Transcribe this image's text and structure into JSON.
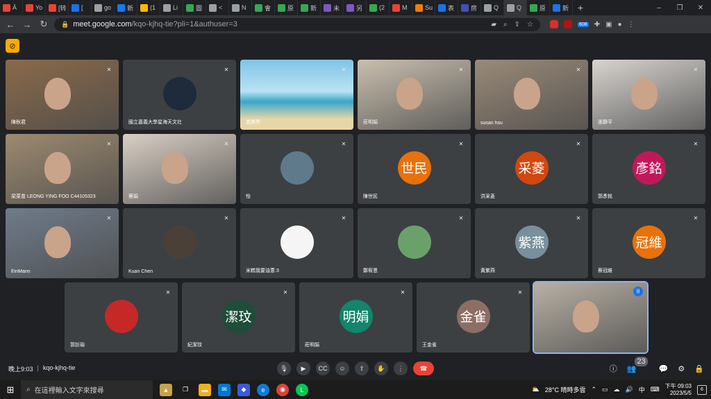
{
  "browser": {
    "tabs": [
      "Ä",
      "Yo",
      "[转",
      "[",
      "go",
      "新",
      "(1",
      "Li",
      "圖",
      "<",
      "N",
      "會",
      "原",
      "新",
      "未",
      "另",
      "(2",
      "M",
      "Su",
      "表",
      "房",
      "Q",
      "Q",
      "原",
      "新"
    ],
    "url_host": "meet.google.com",
    "url_path": "/kqo-kjhq-tie?pli=1&authuser=3",
    "ext_badge": "608"
  },
  "participants": [
    {
      "name": "陳秋君",
      "type": "video",
      "bg": "#8a6a4a"
    },
    {
      "name": "國立嘉義大學星海天文社",
      "type": "avatar",
      "initials": "",
      "color": "#1e2b3a"
    },
    {
      "name": "曾美秀",
      "type": "beach"
    },
    {
      "name": "莊明娟",
      "type": "video",
      "bg": "#c9bfae"
    },
    {
      "name": "susan hsu",
      "type": "video",
      "bg": "#9a8a78"
    },
    {
      "name": "張靜平",
      "type": "video",
      "bg": "#d8d4cf"
    },
    {
      "name": "梁菜苗 LEONG YING FOO C44105323",
      "type": "video",
      "bg": "#9d8a70"
    },
    {
      "name": "蔡娟",
      "type": "video",
      "bg": "#d9cfc4"
    },
    {
      "name": "怡",
      "type": "avatar",
      "initials": "",
      "color": "#5f7a8a"
    },
    {
      "name": "陳世民",
      "type": "avatar",
      "initials": "世民",
      "color": "#e8710a"
    },
    {
      "name": "洪采菱",
      "type": "avatar",
      "initials": "采菱",
      "color": "#d2480e"
    },
    {
      "name": "郭彥銘",
      "type": "avatar",
      "initials": "彥銘",
      "color": "#c2185b"
    },
    {
      "name": "EinMann",
      "type": "video",
      "bg": "#6f7b8a"
    },
    {
      "name": "Kuan Chen",
      "type": "avatar",
      "initials": "",
      "color": "#4a4038"
    },
    {
      "name": "米糕我要油蔥:3",
      "type": "avatar",
      "initials": "",
      "color": "#f5f5f5"
    },
    {
      "name": "鄭宥恩",
      "type": "avatar",
      "initials": "",
      "color": "#6aa16a"
    },
    {
      "name": "黃紫燕",
      "type": "avatar",
      "initials": "紫燕",
      "color": "#78909c"
    },
    {
      "name": "蔡冠維",
      "type": "avatar",
      "initials": "冠維",
      "color": "#e8710a"
    },
    {
      "name": "郭訢瑜",
      "type": "avatar",
      "initials": "",
      "color": "#c62828"
    },
    {
      "name": "紀潔玟",
      "type": "avatar",
      "initials": "潔玟",
      "color": "#1e4d3a"
    },
    {
      "name": "莊明娟",
      "type": "avatar",
      "initials": "明娟",
      "color": "#12856b"
    },
    {
      "name": "王金雀",
      "type": "avatar",
      "initials": "金雀",
      "color": "#8d6e63"
    },
    {
      "name": "",
      "type": "speaker",
      "bg": "#b8b0a4"
    }
  ],
  "meeting": {
    "time": "晚上9:03",
    "code": "kqo-kjhq-tie",
    "participant_count": "23"
  },
  "taskbar": {
    "search_placeholder": "在這裡輸入文字來搜尋",
    "weather": "28°C 晴時多雲",
    "ime": "中",
    "time": "下午 09:03",
    "date": "2023/5/5",
    "notif_count": "6"
  }
}
